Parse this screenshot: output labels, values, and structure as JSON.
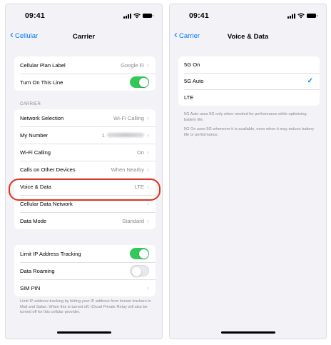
{
  "left": {
    "status_time": "09:41",
    "back_label": "Cellular",
    "title": "Carrier",
    "group1": [
      {
        "label": "Cellular Plan Label",
        "value": "Google Fi"
      },
      {
        "label": "Turn On This Line",
        "toggle": "on"
      }
    ],
    "carrier_header": "CARRIER",
    "group2": [
      {
        "label": "Network Selection",
        "value": "Wi-Fi Calling"
      },
      {
        "label": "My Number",
        "value": "1"
      },
      {
        "label": "Wi-Fi Calling",
        "value": "On"
      },
      {
        "label": "Calls on Other Devices",
        "value": "When Nearby"
      },
      {
        "label": "Voice & Data",
        "value": "LTE"
      },
      {
        "label": "Cellular Data Network",
        "value": ""
      },
      {
        "label": "Data Mode",
        "value": "Standard"
      }
    ],
    "group3": [
      {
        "label": "Limit IP Address Tracking",
        "toggle": "on"
      },
      {
        "label": "Data Roaming",
        "toggle": "off"
      },
      {
        "label": "SIM PIN",
        "value": ""
      }
    ],
    "footer": "Limit IP address tracking by hiding your IP address from known trackers in Mail and Safari. When this is turned off, iCloud Private Relay will also be turned off for this cellular provider."
  },
  "right": {
    "status_time": "09:41",
    "back_label": "Carrier",
    "title": "Voice & Data",
    "options": [
      {
        "label": "5G On",
        "selected": false
      },
      {
        "label": "5G Auto",
        "selected": true
      },
      {
        "label": "LTE",
        "selected": false
      }
    ],
    "check_glyph": "✓",
    "note1": "5G Auto uses 5G only when needed for performance while optimizing battery life.",
    "note2": "5G On uses 5G whenever it is available, even when it may reduce battery life or performance."
  },
  "colors": {
    "accent": "#007aff",
    "toggle_on": "#34c759",
    "highlight": "#e0321f",
    "background": "#f2f2f7"
  },
  "icons": [
    "signal-icon",
    "wifi-icon",
    "battery-icon",
    "chevron-left-icon",
    "chevron-right-icon",
    "checkmark-icon"
  ]
}
